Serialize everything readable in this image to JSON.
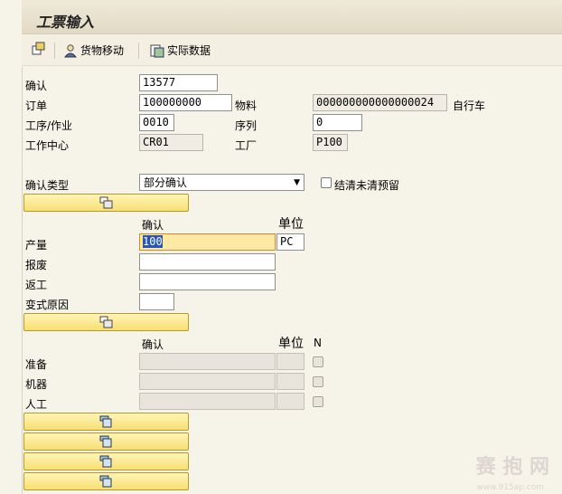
{
  "window": {
    "title": "工票输入"
  },
  "toolbar": {
    "goods_movement": "货物移动",
    "actual_data": "实际数据"
  },
  "form": {
    "confirmation": {
      "label": "确认",
      "value": "13577"
    },
    "order": {
      "label": "订单",
      "value": "100000000"
    },
    "material": {
      "label": "物料",
      "value": "000000000000000024",
      "desc": "自行车"
    },
    "operation": {
      "label": "工序/作业",
      "value": "0010"
    },
    "sequence": {
      "label": "序列",
      "value": "0"
    },
    "work_center": {
      "label": "工作中心",
      "value": "CR01"
    },
    "plant": {
      "label": "工厂",
      "value": "P100"
    },
    "confirm_type": {
      "label": "确认类型",
      "selected": "部分确认"
    },
    "clear_reservations": {
      "label": "结清未清预留"
    }
  },
  "quantities": {
    "col_confirm": "确认",
    "col_unit": "单位",
    "yield": {
      "label": "产量",
      "value": "100",
      "unit": "PC"
    },
    "scrap": {
      "label": "报废"
    },
    "rework": {
      "label": "返工"
    },
    "variance_reason": {
      "label": "变式原因"
    }
  },
  "activities": {
    "col_confirm": "确认",
    "col_unit": "单位",
    "col_n": "N",
    "setup": {
      "label": "准备"
    },
    "machine": {
      "label": "机器"
    },
    "labor": {
      "label": "人工"
    }
  },
  "watermark": {
    "brand": "赛 抱 网",
    "url": "www.915ap.com"
  },
  "colors": {
    "button_yellow": "#f7df73",
    "highlight": "#2a55b5"
  }
}
